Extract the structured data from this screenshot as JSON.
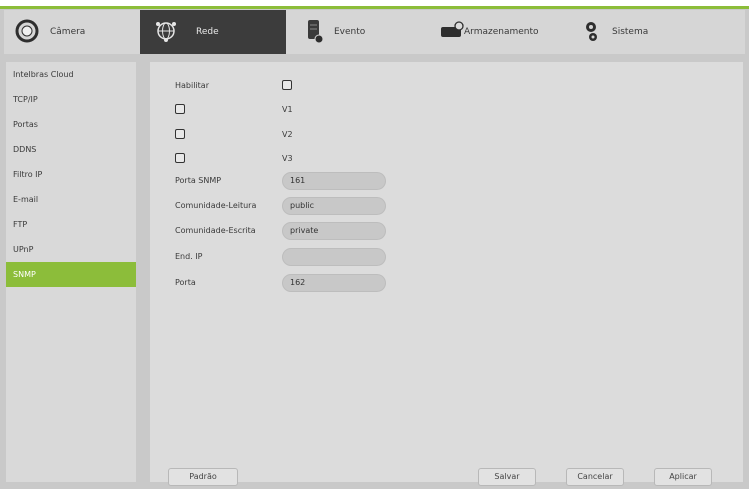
{
  "nav": {
    "tabs": [
      {
        "label": "Câmera",
        "icon": "camera-icon"
      },
      {
        "label": "Rede",
        "icon": "network-globe-icon"
      },
      {
        "label": "Evento",
        "icon": "event-icon"
      },
      {
        "label": "Armazenamento",
        "icon": "storage-icon"
      },
      {
        "label": "Sistema",
        "icon": "system-gears-icon"
      }
    ],
    "active": "Rede"
  },
  "sidebar": {
    "items": [
      {
        "label": "Intelbras Cloud"
      },
      {
        "label": "TCP/IP"
      },
      {
        "label": "Portas"
      },
      {
        "label": "DDNS"
      },
      {
        "label": "Filtro IP"
      },
      {
        "label": "E-mail"
      },
      {
        "label": "FTP"
      },
      {
        "label": "UPnP"
      },
      {
        "label": "SNMP"
      }
    ],
    "active": "SNMP"
  },
  "form": {
    "habilitar_label": "Habilitar",
    "v1_label": "V1",
    "v2_label": "V2",
    "v3_label": "V3",
    "porta_snmp_label": "Porta SNMP",
    "porta_snmp_value": "161",
    "comunidade_leitura_label": "Comunidade-Leitura",
    "comunidade_leitura_value": "public",
    "comunidade_escrita_label": "Comunidade-Escrita",
    "comunidade_escrita_value": "private",
    "end_ip_label": "End. IP",
    "end_ip_value": "",
    "porta_label": "Porta",
    "porta_value": "162"
  },
  "buttons": {
    "padrao": "Padrão",
    "salvar": "Salvar",
    "cancelar": "Cancelar",
    "aplicar": "Aplicar"
  },
  "colors": {
    "accent": "#8cbd3a",
    "active_tab": "#3c3c3c"
  }
}
